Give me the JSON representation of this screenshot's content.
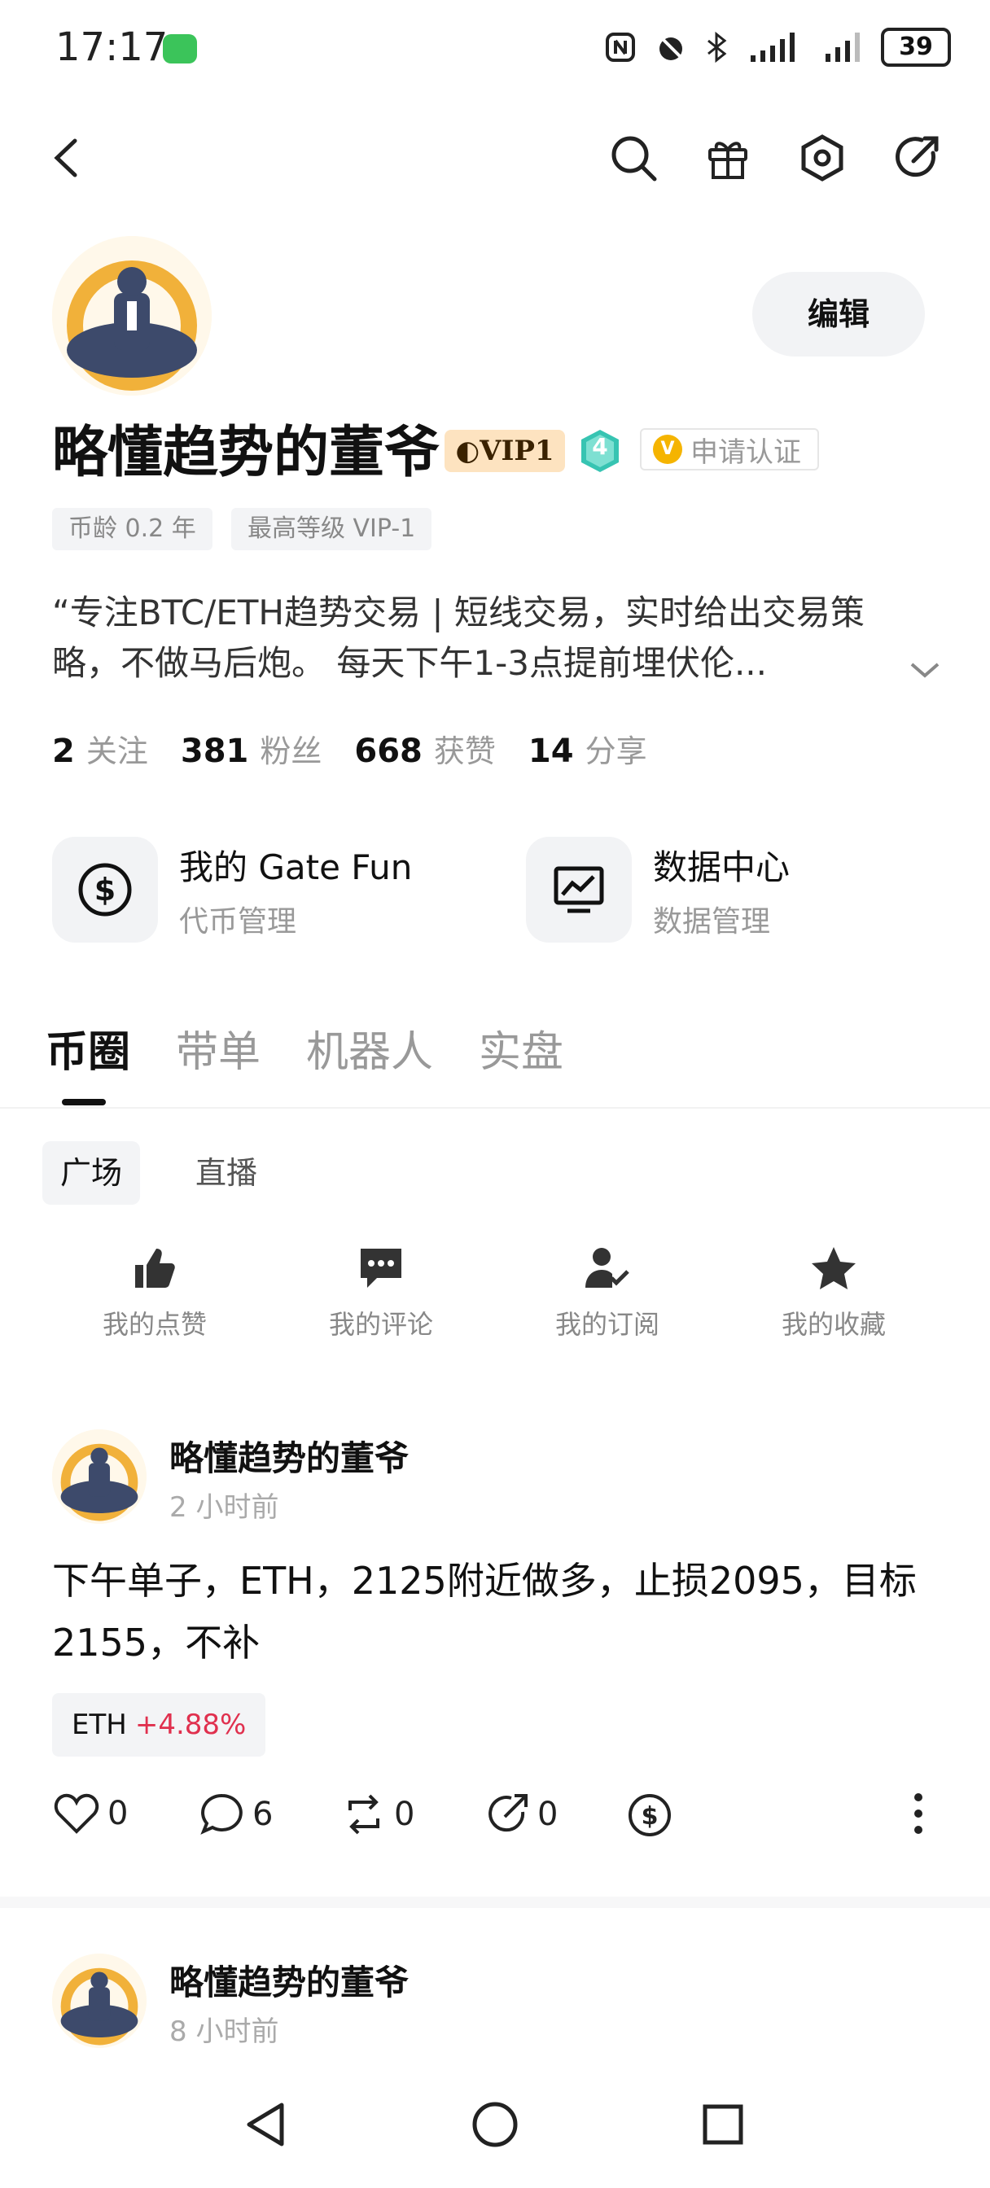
{
  "status": {
    "time": "17:17",
    "battery": "39"
  },
  "header": {
    "icons": [
      "back-icon",
      "search-icon",
      "gift-icon",
      "settings-icon",
      "share-icon"
    ]
  },
  "profile": {
    "edit_label": "编辑",
    "name": "略懂趋势的董爷",
    "vip_badge": "VIP1",
    "level": "4",
    "verify_label": "申请认证",
    "tags": [
      "币龄 0.2 年",
      "最高等级 VIP-1"
    ],
    "bio": "“专注BTC/ETH趋势交易 | 短线交易，实时给出交易策略，不做马后炮。 每天下午1-3点提前埋伏伦...",
    "stats": [
      {
        "value": "2",
        "label": "关注"
      },
      {
        "value": "381",
        "label": "粉丝"
      },
      {
        "value": "668",
        "label": "获赞"
      },
      {
        "value": "14",
        "label": "分享"
      }
    ]
  },
  "cards": [
    {
      "title": "我的 Gate Fun",
      "subtitle": "代币管理",
      "icon": "dollar-circle-icon"
    },
    {
      "title": "数据中心",
      "subtitle": "数据管理",
      "icon": "chart-monitor-icon"
    }
  ],
  "tabs": [
    "币圈",
    "带单",
    "机器人",
    "实盘"
  ],
  "subtabs": [
    "广场",
    "直播"
  ],
  "actions": [
    {
      "label": "我的点赞",
      "icon": "thumbs-up-icon"
    },
    {
      "label": "我的评论",
      "icon": "comment-icon"
    },
    {
      "label": "我的订阅",
      "icon": "subscribe-user-icon"
    },
    {
      "label": "我的收藏",
      "icon": "star-icon"
    }
  ],
  "posts": [
    {
      "author": "略懂趋势的董爷",
      "time": "2 小时前",
      "body": "下午单子，ETH，2125附近做多，止损2095，目标2155，不补",
      "coin": "ETH",
      "change": "+4.88%",
      "likes": "0",
      "comments": "6",
      "reposts": "0",
      "shares": "0"
    },
    {
      "author": "略懂趋势的董爷",
      "time": "8 小时前"
    }
  ]
}
